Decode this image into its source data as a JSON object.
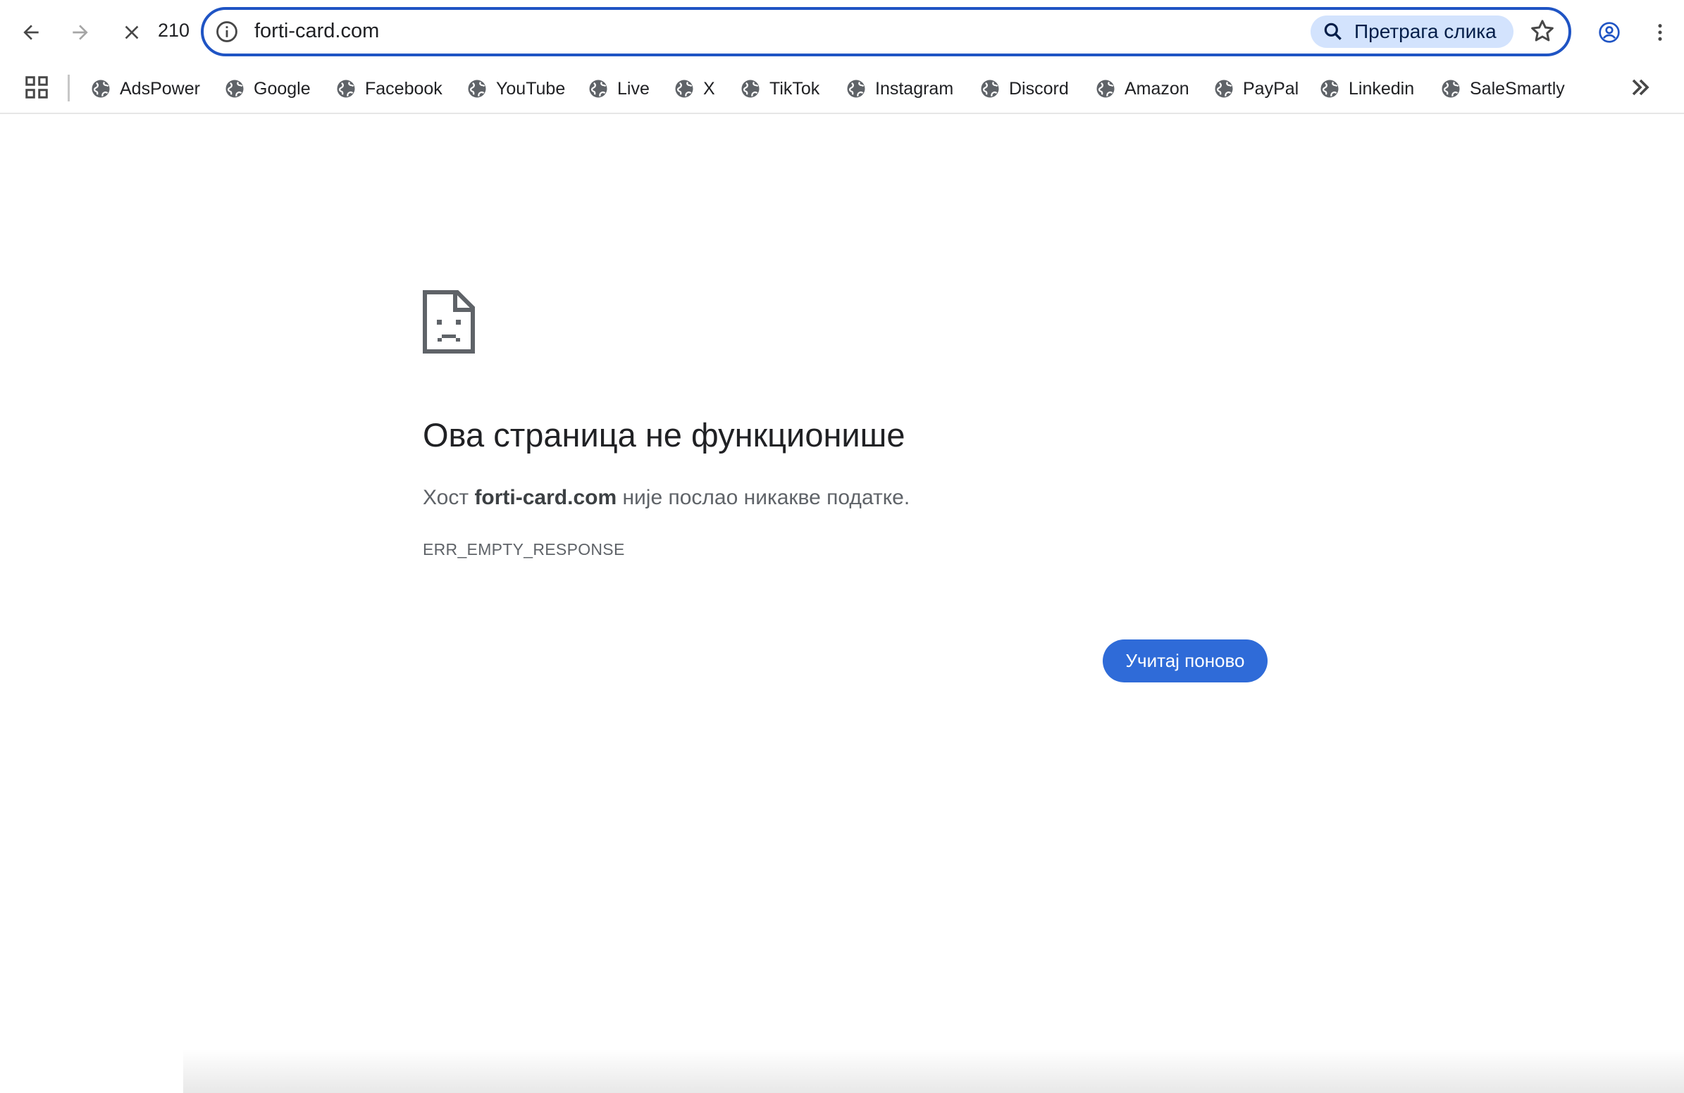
{
  "toolbar": {
    "zoom_text": "210",
    "url": "forti-card.com",
    "image_search_label": "Претрага слика"
  },
  "bookmarks": [
    {
      "label": "AdsPower"
    },
    {
      "label": "Google"
    },
    {
      "label": "Facebook"
    },
    {
      "label": "YouTube"
    },
    {
      "label": "Live"
    },
    {
      "label": "X"
    },
    {
      "label": "TikTok"
    },
    {
      "label": "Instagram"
    },
    {
      "label": "Discord"
    },
    {
      "label": "Amazon"
    },
    {
      "label": "PayPal"
    },
    {
      "label": "Linkedin"
    },
    {
      "label": "SaleSmartly"
    }
  ],
  "error": {
    "title": "Ова страница не функционише",
    "desc_prefix": "Хост ",
    "desc_host": "forti-card.com",
    "desc_suffix": " није послао никакве податке.",
    "code": "ERR_EMPTY_RESPONSE",
    "reload_label": "Учитај поново"
  },
  "colors": {
    "accent": "#1f54c4",
    "button": "#2f6bd8",
    "image_search_bg": "#d3e3fd"
  },
  "icons": {
    "back": "arrow-left-icon",
    "forward": "arrow-right-icon",
    "stop": "close-icon",
    "info": "info-icon",
    "search": "search-icon",
    "star": "star-icon",
    "profile": "account-icon",
    "menu": "kebab-menu-icon",
    "apps": "apps-grid-icon",
    "bookmark": "globe-icon",
    "more": "chevron-double-right-icon",
    "error": "sad-page-icon"
  }
}
